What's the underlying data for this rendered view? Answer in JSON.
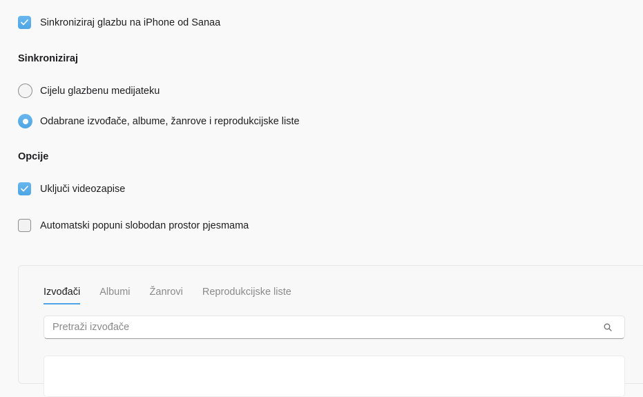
{
  "sync_music": {
    "label": "Sinkroniziraj glazbu na iPhone od Sanaa",
    "checked": true
  },
  "sync_section": {
    "title": "Sinkroniziraj",
    "options": [
      {
        "label": "Cijelu glazbenu medijateku",
        "selected": false
      },
      {
        "label": "Odabrane izvođače, albume, žanrove i reprodukcijske liste",
        "selected": true
      }
    ]
  },
  "options_section": {
    "title": "Opcije",
    "include_videos": {
      "label": "Uključi videozapise",
      "checked": true
    },
    "autofill": {
      "label": "Automatski popuni slobodan prostor pjesmama",
      "checked": false
    }
  },
  "tabs": [
    {
      "label": "Izvođači",
      "active": true
    },
    {
      "label": "Albumi",
      "active": false
    },
    {
      "label": "Žanrovi",
      "active": false
    },
    {
      "label": "Reprodukcijske liste",
      "active": false
    }
  ],
  "search": {
    "placeholder": "Pretraži izvođače",
    "value": ""
  },
  "colors": {
    "accent": "#4ea6e4",
    "background": "#f9f9f9"
  },
  "icons": {
    "check": "checkmark-icon",
    "search": "search-icon"
  }
}
